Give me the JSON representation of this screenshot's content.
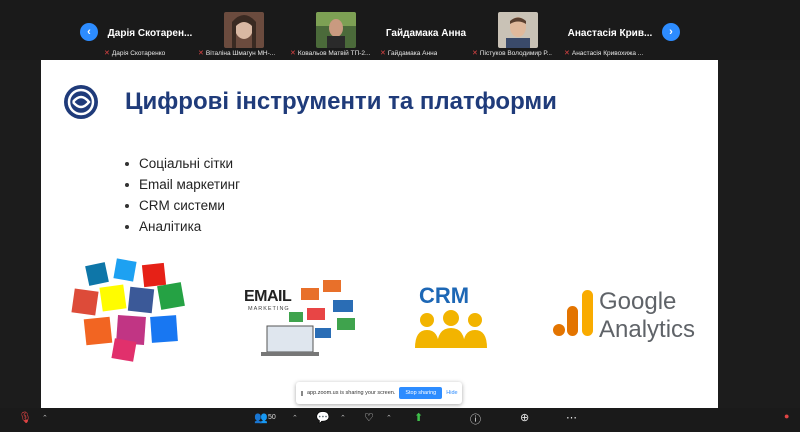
{
  "participants": [
    {
      "big_name": "Дарія Скотарен...",
      "caption": "Дарія Скотаренко",
      "has_photo": false
    },
    {
      "big_name": "",
      "caption": "Віталіна Шмагун МН-...",
      "has_photo": true
    },
    {
      "big_name": "",
      "caption": "Ковальов Матвій ТП-2...",
      "has_photo": true
    },
    {
      "big_name": "Гайдамака Анна",
      "caption": "Гайдамака Анна",
      "has_photo": false
    },
    {
      "big_name": "",
      "caption": "Пістуков Володимир Р...",
      "has_photo": true
    },
    {
      "big_name": "Анастасія Крив...",
      "caption": "Анастасія Кривохижа ...",
      "has_photo": false
    }
  ],
  "slide": {
    "title": "Цифрові інструменти та платформи",
    "bullets": [
      "Соціальні сітки",
      "Email маркетинг",
      "CRM системи",
      "Аналітика"
    ],
    "email_word": "EMAIL",
    "email_sub": "MARKETING",
    "crm_word": "CRM",
    "ga_line1": "Google",
    "ga_line2": "Analytics"
  },
  "share_banner": {
    "text": "app.zoom.us is sharing your screen.",
    "stop_label": "Stop sharing",
    "hide_label": "Hide"
  },
  "toolbar": {
    "participants_count": "50"
  },
  "colors": {
    "accent": "#2d8cff",
    "title": "#1f3b7a",
    "crm_blue": "#1d67b5",
    "crm_yellow": "#f2b400",
    "ga_orange": "#f9ab00",
    "ga_dark_orange": "#e37400"
  }
}
